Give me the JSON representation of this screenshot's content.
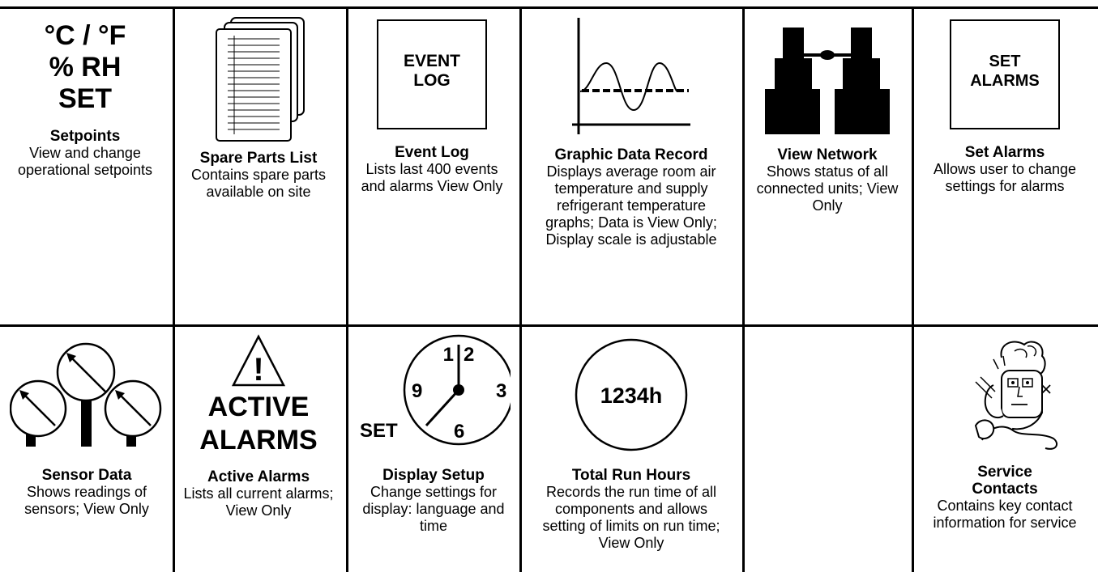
{
  "icons": {
    "setpoints": {
      "line1": "°C / °F",
      "line2": "% RH",
      "line3": "SET"
    },
    "event_log": {
      "line1": "EVENT",
      "line2": "LOG"
    },
    "set_alarms": {
      "line1": "SET",
      "line2": "ALARMS"
    },
    "active_alarms": {
      "mark": "!",
      "line1": "ACTIVE",
      "line2": "ALARMS"
    },
    "clock": {
      "n12a": "1",
      "n12b": "2",
      "n3": "3",
      "n6": "6",
      "n9": "9",
      "set": "SET"
    },
    "run_hours": {
      "value": "1234h"
    }
  },
  "row1": [
    {
      "title": "Setpoints",
      "desc": "View and change operational setpoints"
    },
    {
      "title": "Spare Parts List",
      "desc": "Contains spare parts available on site"
    },
    {
      "title": "Event Log",
      "desc": "Lists last 400 events and alarms View Only"
    },
    {
      "title": "Graphic Data Record",
      "desc": "Displays average room air temperature and supply refrigerant temperature graphs; Data is View Only; Display scale is adjustable"
    },
    {
      "title": "View Network",
      "desc": "Shows status of all connected units; View Only"
    },
    {
      "title": "Set Alarms",
      "desc": "Allows user to change settings for alarms"
    }
  ],
  "row2": [
    {
      "title": "Sensor Data",
      "desc": "Shows readings of sensors; View Only"
    },
    {
      "title": "Active Alarms",
      "desc": "Lists all current alarms; View Only"
    },
    {
      "title": "Display Setup",
      "desc": "Change settings for display: language and time"
    },
    {
      "title": "Total Run Hours",
      "desc": "Records the run time of all components and allows setting of limits on run time; View Only"
    },
    {
      "title": "",
      "desc": ""
    },
    {
      "title": "Service Contacts",
      "desc": "Contains key contact information for service"
    }
  ]
}
